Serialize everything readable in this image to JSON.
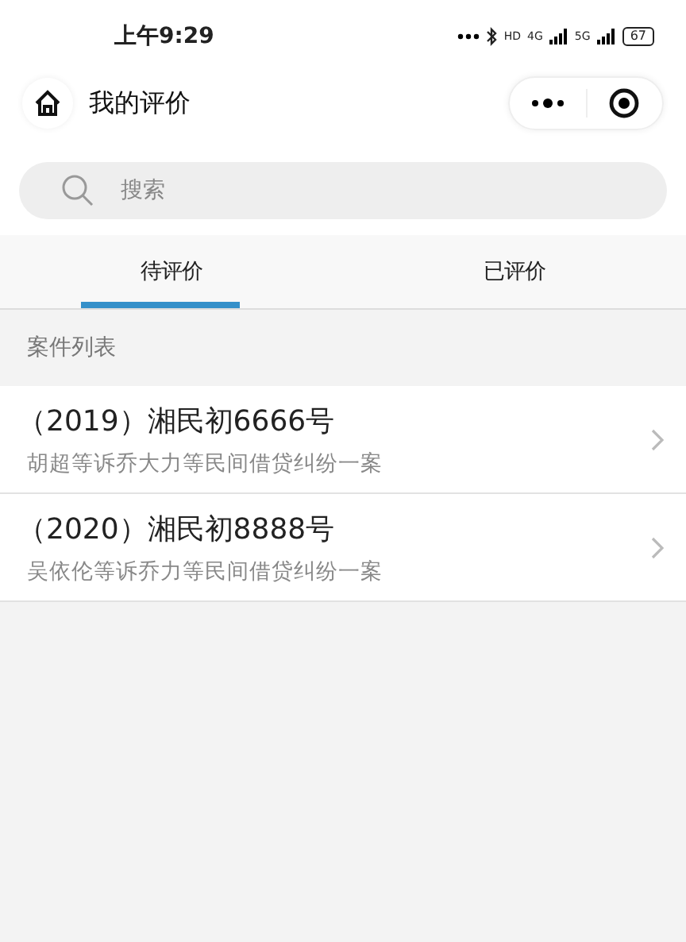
{
  "status_bar": {
    "time": "上午9:29",
    "network_labels": [
      "HD",
      "4G",
      "5G"
    ],
    "battery": "67"
  },
  "nav": {
    "title": "我的评价"
  },
  "search": {
    "placeholder": "搜索"
  },
  "tabs": [
    {
      "label": "待评价",
      "selected": true
    },
    {
      "label": "已评价",
      "selected": false
    }
  ],
  "section": {
    "title": "案件列表"
  },
  "cases": [
    {
      "title": "（2019）湘民初6666号",
      "subtitle": "胡超等诉乔大力等民间借贷纠纷一案"
    },
    {
      "title": "（2020）湘民初8888号",
      "subtitle": "吴依伦等诉乔力等民间借贷纠纷一案"
    }
  ]
}
